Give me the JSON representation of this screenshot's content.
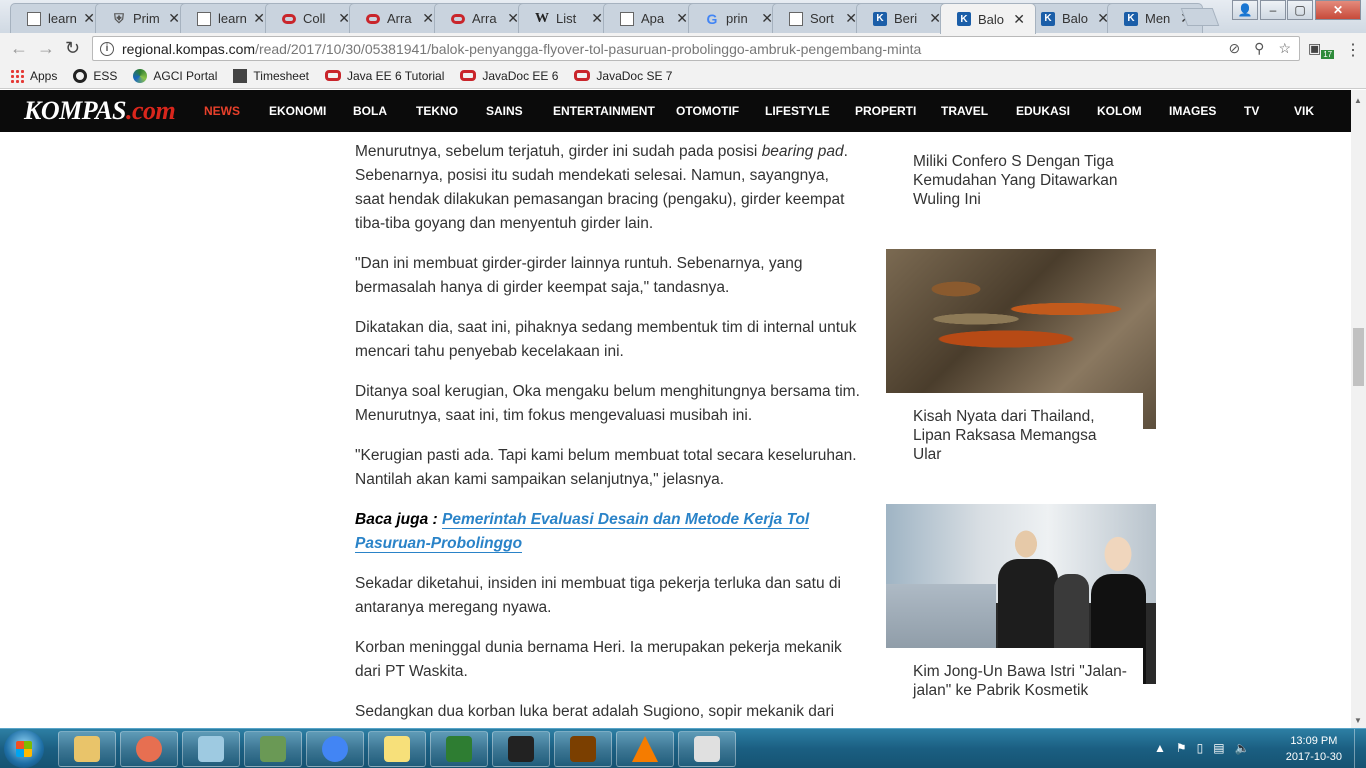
{
  "browser": {
    "tabs": [
      {
        "title": "learn",
        "favicon": "doc-icon"
      },
      {
        "title": "Prim",
        "favicon": "shield-icon"
      },
      {
        "title": "learn",
        "favicon": "doc-icon"
      },
      {
        "title": "Coll",
        "favicon": "oracle-icon"
      },
      {
        "title": "Arra",
        "favicon": "oracle-icon"
      },
      {
        "title": "Arra",
        "favicon": "oracle-icon"
      },
      {
        "title": "List",
        "favicon": "wikipedia-icon"
      },
      {
        "title": "Apa",
        "favicon": "doc-icon"
      },
      {
        "title": "prin",
        "favicon": "google-icon"
      },
      {
        "title": "Sort",
        "favicon": "doc-icon"
      },
      {
        "title": "Beri",
        "favicon": "kompas-icon"
      },
      {
        "title": "Balo",
        "favicon": "kompas-icon",
        "active": true
      },
      {
        "title": "Balo",
        "favicon": "kompas-icon"
      },
      {
        "title": "Men",
        "favicon": "kompas-icon"
      }
    ],
    "close_glyph": "✕",
    "url_host": "regional.kompas.com",
    "url_path": "/read/2017/10/30/05381941/balok-penyangga-flyover-tol-pasuruan-probolinggo-ambruk-pengembang-minta",
    "extension_badge": "17",
    "bookmarks": [
      {
        "label": "Apps",
        "icon": "apps-grid-icon"
      },
      {
        "label": "ESS",
        "icon": "circle-icon"
      },
      {
        "label": "AGCI Portal",
        "icon": "agci-icon"
      },
      {
        "label": "Timesheet",
        "icon": "timesheet-icon"
      },
      {
        "label": "Java EE 6 Tutorial",
        "icon": "oracle-icon"
      },
      {
        "label": "JavaDoc EE 6",
        "icon": "oracle-icon"
      },
      {
        "label": "JavaDoc SE 7",
        "icon": "oracle-icon"
      }
    ]
  },
  "site": {
    "logo_main": "KOMPAS",
    "logo_suffix": ".com",
    "nav": [
      "NEWS",
      "EKONOMI",
      "BOLA",
      "TEKNO",
      "SAINS",
      "ENTERTAINMENT",
      "OTOMOTIF",
      "LIFESTYLE",
      "PROPERTI",
      "TRAVEL",
      "EDUKASI",
      "KOLOM",
      "IMAGES",
      "TV",
      "VIK"
    ],
    "active_nav": "NEWS",
    "accent_color": "#e8402b",
    "link_color": "#2a83c8"
  },
  "article": {
    "p1_a": "Menurutnya, sebelum terjatuh, girder ini sudah pada posisi ",
    "p1_em": "bearing pad",
    "p1_b": ". Sebenarnya, posisi itu sudah mendekati selesai. Namun, sayangnya, saat hendak dilakukan pemasangan bracing (pengaku), girder keempat tiba-tiba goyang dan menyentuh girder lain.",
    "p2": "\"Dan ini membuat girder-girder lainnya runtuh. Sebenarnya, yang bermasalah hanya di girder keempat saja,\" tandasnya.",
    "p3": "Dikatakan dia, saat ini, pihaknya sedang membentuk tim di internal untuk mencari tahu penyebab kecelakaan ini.",
    "p4": "Ditanya soal kerugian, Oka mengaku belum menghitungnya bersama tim. Menurutnya, saat ini, tim fokus mengevaluasi musibah ini.",
    "p5": "\"Kerugian pasti ada. Tapi kami belum membuat total secara keseluruhan. Nantilah akan kami sampaikan selanjutnya,\" jelasnya.",
    "baca_label": "Baca juga : ",
    "baca_link": "Pemerintah Evaluasi Desain dan Metode Kerja Tol Pasuruan-Probolinggo",
    "p6": "Sekadar diketahui, insiden ini membuat tiga pekerja terluka dan satu di antaranya meregang nyawa.",
    "p7": "Korban meninggal dunia bernama Heri. Ia merupakan pekerja mekanik dari PT Waskita.",
    "p8": "Sedangkan dua korban luka berat adalah Sugiono, sopir mekanik dari"
  },
  "sidebar": [
    {
      "title": "Miliki Confero S Dengan Tiga Kemudahan Yang Ditawarkan Wuling Ini"
    },
    {
      "title": "Kisah Nyata dari Thailand, Lipan Raksasa Memangsa Ular"
    },
    {
      "title": "Kim Jong-Un Bawa Istri \"Jalan-jalan\" ke Pabrik Kosmetik"
    }
  ],
  "taskbar": {
    "apps": [
      "explorer-icon",
      "firefox-icon",
      "notepad-icon",
      "notepadpp-icon",
      "chrome-icon",
      "sticky-notes-icon",
      "task-manager-icon",
      "image-viewer-icon",
      "java-ee-ide-icon",
      "vlc-icon",
      "paint-icon"
    ],
    "time": "13:09 PM",
    "date": "2017-10-30"
  }
}
